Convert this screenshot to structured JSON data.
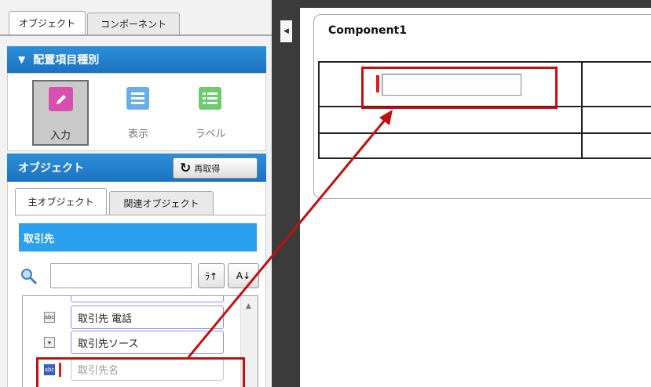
{
  "tabs": [
    "オブジェクト",
    "コンポーネント"
  ],
  "placement": {
    "header": "配置項目種別",
    "items": [
      {
        "label": "入力",
        "icon": "pencil-icon",
        "color": "#d94fb0",
        "selected": true
      },
      {
        "label": "表示",
        "icon": "list-icon",
        "color": "#6aaee6",
        "selected": false
      },
      {
        "label": "ラベル",
        "icon": "grid-list-icon",
        "color": "#6ccb6c",
        "selected": false
      }
    ]
  },
  "objects": {
    "header": "オブジェクト",
    "refetch_label": "再取得",
    "tabs": [
      "主オブジェクト",
      "関連オブジェクト"
    ],
    "selected_object": "取引先",
    "search_value": "",
    "sort_buttons": [
      "ﾗ↑",
      "A↓"
    ],
    "fields": [
      {
        "label": "取引先 電話",
        "type_icon": "abc"
      },
      {
        "label": "取引先ソース",
        "type_icon": "select"
      },
      {
        "label": "取引先名",
        "type_icon": "abc"
      }
    ]
  },
  "component": {
    "title": "Component1"
  },
  "colors": {
    "accent_blue": "#1a73c2",
    "highlight_blue": "#2aa0ee",
    "annotation_red": "#c01010"
  }
}
